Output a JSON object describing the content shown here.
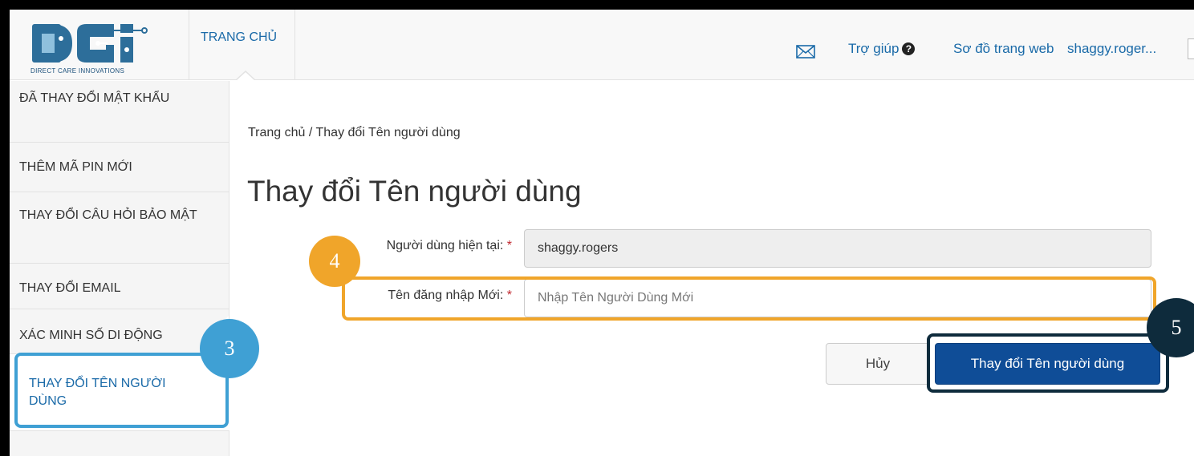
{
  "header": {
    "logo_text": "DIRECT CARE INNOVATIONS",
    "nav_home": "TRANG CHỦ",
    "help": "Trợ giúp",
    "sitemap": "Sơ đồ trang web",
    "user": "shaggy.roger...",
    "icons": {
      "mail": "mail-icon",
      "help": "question-circle-icon"
    }
  },
  "sidebar": {
    "items": [
      {
        "label": "ĐÃ THAY ĐỔI MẬT KHẨU"
      },
      {
        "label": "THÊM MÃ PIN MỚI"
      },
      {
        "label": "THAY ĐỔI CÂU HỎI BẢO MẬT"
      },
      {
        "label": "THAY ĐỔI EMAIL"
      },
      {
        "label": "XÁC MINH SỐ DI ĐỘNG"
      },
      {
        "label": "THAY ĐỔI TÊN NGƯỜI DÙNG"
      }
    ],
    "active_index": 5
  },
  "main": {
    "breadcrumb": "Trang chủ / Thay đổi Tên người dùng",
    "title": "Thay đổi Tên người dùng",
    "current_user_label": "Người dùng hiện tại:",
    "current_user_value": "shaggy.rogers",
    "new_username_label": "Tên đăng nhập Mới:",
    "new_username_placeholder": "Nhập Tên Người Dùng Mới",
    "required_mark": "*",
    "cancel_label": "Hủy",
    "submit_label": "Thay đổi Tên người dùng"
  },
  "callouts": {
    "one": "3",
    "two": "4",
    "three": "5"
  },
  "colors": {
    "accent_blue": "#1a6aa8",
    "primary_button": "#0f4d97",
    "callout_orange": "#f0a52a",
    "callout_blue": "#3fa0d4",
    "callout_dark": "#0e2b3c",
    "required": "#c0262d"
  }
}
